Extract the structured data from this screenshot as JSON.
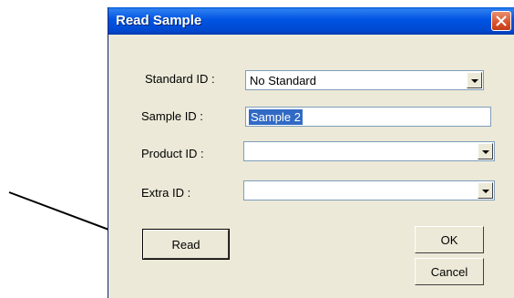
{
  "dialog": {
    "title": "Read Sample",
    "close_icon": "close-icon"
  },
  "fields": {
    "standard_label": "Standard ID :",
    "standard_value": "No Standard",
    "sample_label": "Sample ID :",
    "sample_value": "Sample 2",
    "product_label": "Product ID :",
    "product_value": "",
    "extra_label": "Extra ID :",
    "extra_value": ""
  },
  "buttons": {
    "read": "Read",
    "ok": "OK",
    "cancel": "Cancel"
  },
  "colors": {
    "titlebar": "#0054e3",
    "dialog_bg": "#ece9d8",
    "selection": "#316ac5",
    "close_button": "#d9522c"
  }
}
